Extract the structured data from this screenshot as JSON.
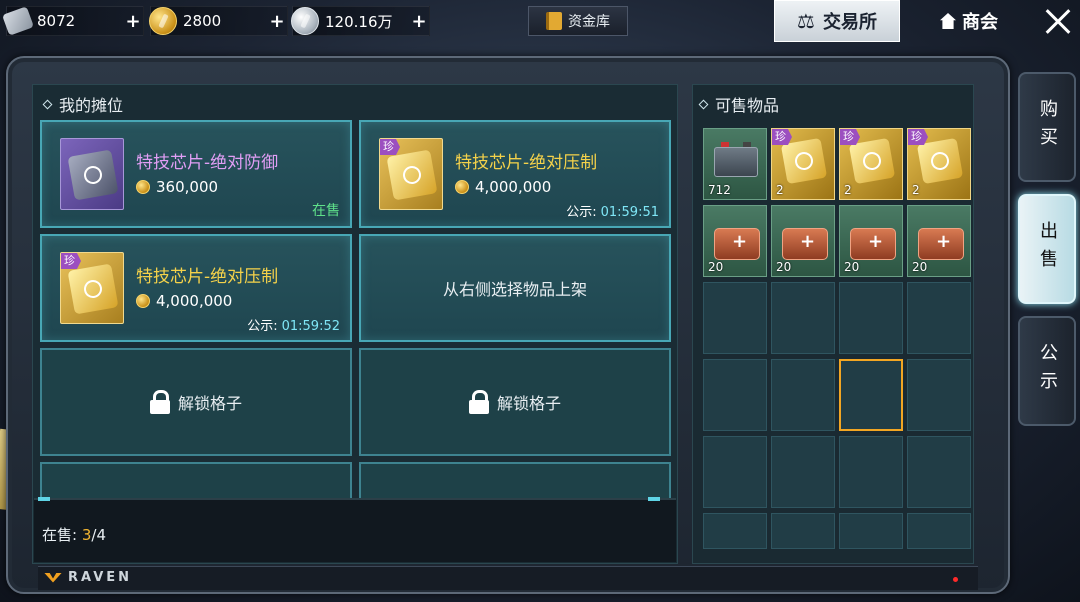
{
  "topbar": {
    "res1": {
      "icon": "card-icon",
      "value": "8072"
    },
    "res2": {
      "icon": "gold-coin-icon",
      "value": "2800"
    },
    "res3": {
      "icon": "silver-coin-icon",
      "value": "120.16万"
    },
    "plus": "+",
    "fund_label": "资金库",
    "trade_label": "交易所",
    "guild_label": "商会"
  },
  "left": {
    "title": "我的摊位",
    "stalls": [
      {
        "name": "特技芯片-绝对防御",
        "price": "360,000",
        "status": "在售"
      },
      {
        "name": "特技芯片-绝对压制",
        "price": "4,000,000",
        "timer_label": "公示:",
        "timer": "01:59:51",
        "rare": "珍"
      },
      {
        "name": "特技芯片-绝对压制",
        "price": "4,000,000",
        "timer_label": "公示:",
        "timer": "01:59:52",
        "rare": "珍"
      }
    ],
    "empty_hint": "从右侧选择物品上架",
    "locked_label": "解锁格子",
    "on_sale_label": "在售:",
    "on_sale_count": "3",
    "on_sale_total": "/4"
  },
  "right": {
    "title": "可售物品",
    "items": [
      {
        "qty": "712",
        "type": "battery"
      },
      {
        "qty": "2",
        "type": "chip",
        "rare": "珍"
      },
      {
        "qty": "2",
        "type": "chip",
        "rare": "珍"
      },
      {
        "qty": "2",
        "type": "chip",
        "rare": "珍"
      },
      {
        "qty": "20",
        "type": "medkit"
      },
      {
        "qty": "20",
        "type": "medkit"
      },
      {
        "qty": "20",
        "type": "medkit"
      },
      {
        "qty": "20",
        "type": "medkit"
      }
    ]
  },
  "tabs": {
    "buy": "购买",
    "sell": "出售",
    "notice": "公示"
  },
  "brand": "RAVEN",
  "colors": {
    "accent": "#48a7b5",
    "gold": "#f5d24a",
    "purple": "#e19ef5",
    "green": "#5fe08a",
    "selected": "#f2a623"
  }
}
